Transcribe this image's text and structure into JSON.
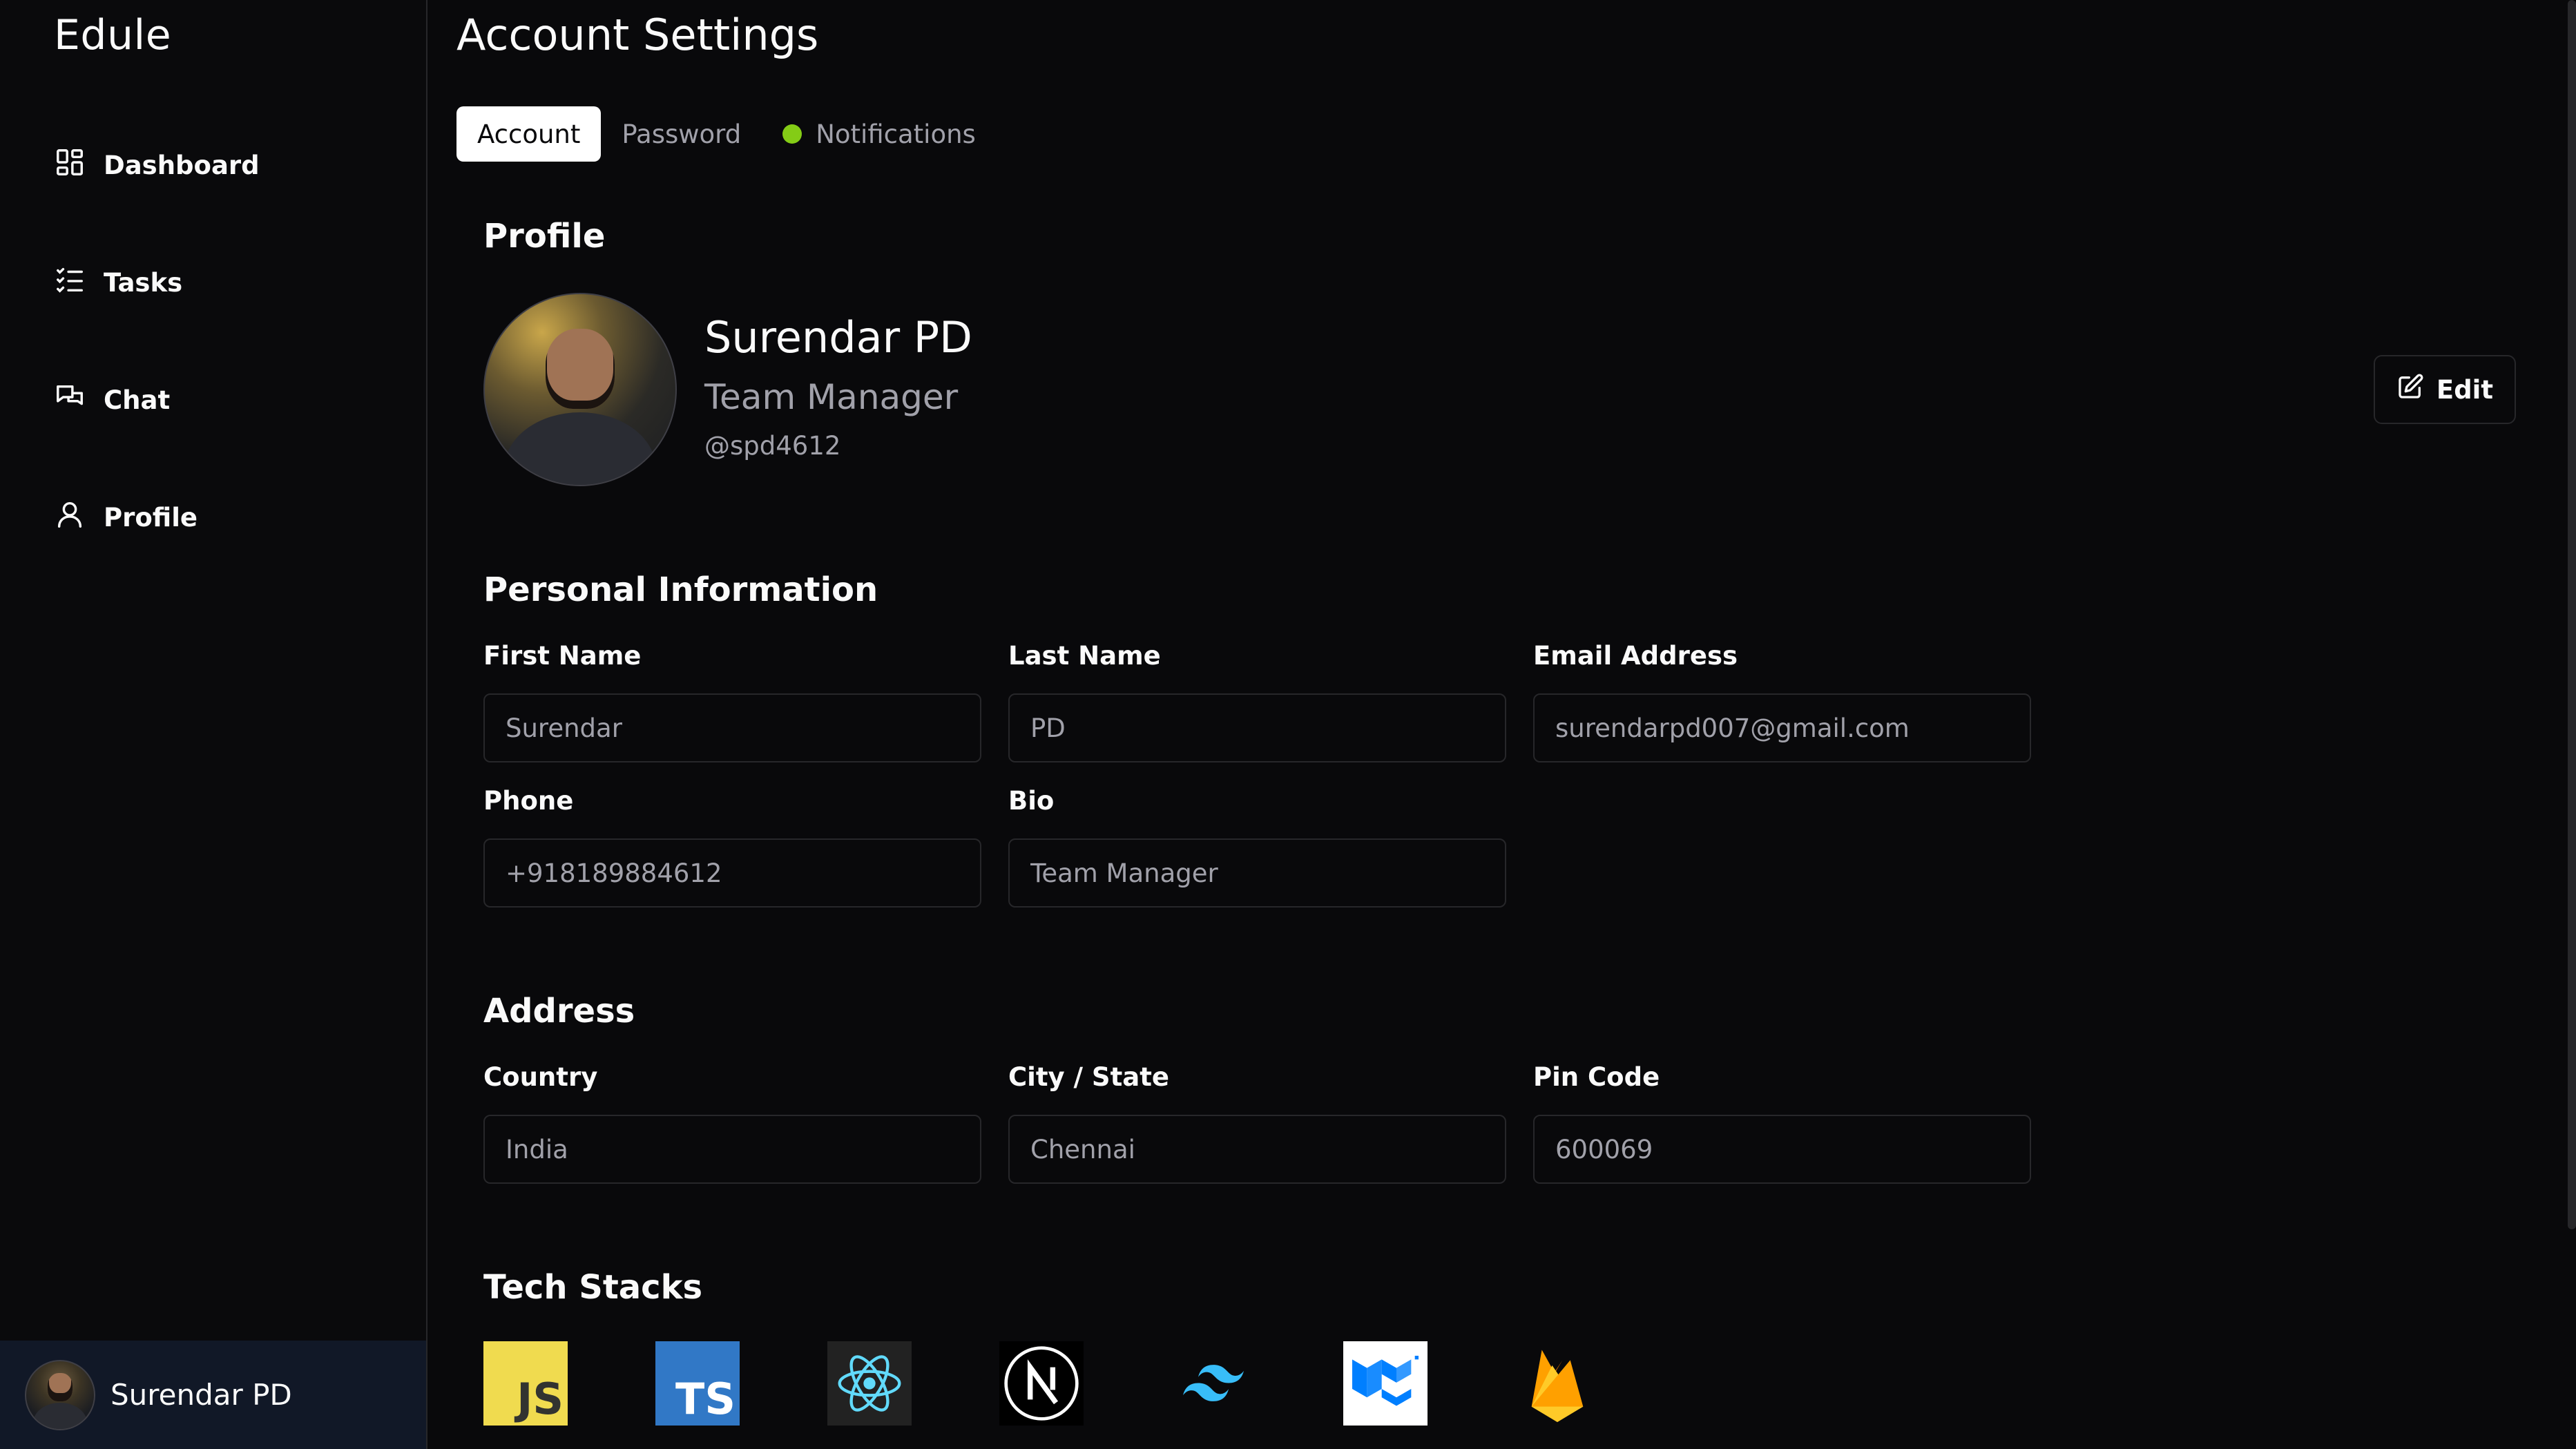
{
  "app": {
    "brand": "Edule",
    "page_title": "Account Settings"
  },
  "sidebar": {
    "items": [
      {
        "label": "Dashboard",
        "icon": "dashboard-grid-icon"
      },
      {
        "label": "Tasks",
        "icon": "list-checks-icon"
      },
      {
        "label": "Chat",
        "icon": "chat-bubbles-icon"
      },
      {
        "label": "Profile",
        "icon": "user-icon"
      }
    ],
    "user": {
      "name": "Surendar PD"
    }
  },
  "tabs": [
    {
      "label": "Account",
      "active": true
    },
    {
      "label": "Password",
      "active": false
    },
    {
      "label": "Notifications",
      "active": false,
      "status_dot_color": "#84cc16"
    }
  ],
  "profile": {
    "section_title": "Profile",
    "name": "Surendar PD",
    "role": "Team Manager",
    "handle": "@spd4612",
    "edit_label": "Edit"
  },
  "personal": {
    "section_title": "Personal Information",
    "first_name": {
      "label": "First Name",
      "value": "Surendar"
    },
    "last_name": {
      "label": "Last Name",
      "value": "PD"
    },
    "email": {
      "label": "Email Address",
      "value": "surendarpd007@gmail.com"
    },
    "phone": {
      "label": "Phone",
      "value": "+918189884612"
    },
    "bio": {
      "label": "Bio",
      "value": "Team Manager"
    }
  },
  "address": {
    "section_title": "Address",
    "country": {
      "label": "Country",
      "value": "India"
    },
    "city": {
      "label": "City / State",
      "value": "Chennai"
    },
    "pin": {
      "label": "Pin Code",
      "value": "600069"
    }
  },
  "tech": {
    "section_title": "Tech Stacks",
    "items": [
      {
        "icon": "javascript-logo-icon",
        "text": "JS"
      },
      {
        "icon": "typescript-logo-icon",
        "text": "TS"
      },
      {
        "icon": "react-logo-icon"
      },
      {
        "icon": "nextjs-logo-icon"
      },
      {
        "icon": "tailwind-logo-icon"
      },
      {
        "icon": "mui-logo-icon"
      },
      {
        "icon": "firebase-logo-icon"
      }
    ]
  },
  "colors": {
    "background": "#09090b",
    "sidebar_user_bg": "#111827",
    "border": "#27272a",
    "muted_text": "#a1a1aa",
    "accent_green": "#84cc16"
  }
}
